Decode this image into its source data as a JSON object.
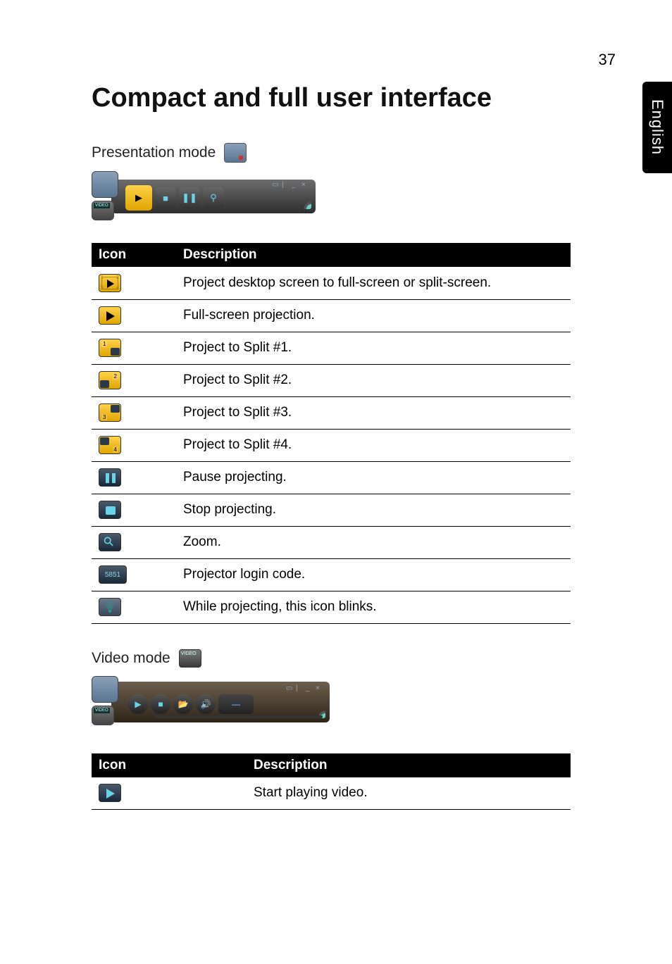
{
  "page_number": "37",
  "side_tab": "English",
  "heading": "Compact and full user interface",
  "presentation": {
    "label": "Presentation mode",
    "table": {
      "headers": {
        "icon": "Icon",
        "desc": "Description"
      },
      "rows": [
        {
          "desc": "Project desktop screen to full-screen or split-screen."
        },
        {
          "desc": "Full-screen projection."
        },
        {
          "desc": "Project to Split #1."
        },
        {
          "desc": "Project to Split #2."
        },
        {
          "desc": "Project to Split #3."
        },
        {
          "desc": "Project to Split #4."
        },
        {
          "desc": "Pause projecting."
        },
        {
          "desc": "Stop projecting."
        },
        {
          "desc": "Zoom."
        },
        {
          "desc": "Projector login code.",
          "code": "5851"
        },
        {
          "desc": "While projecting, this icon blinks."
        }
      ]
    }
  },
  "video": {
    "label": "Video mode",
    "tab_text": "VIDEO",
    "table": {
      "headers": {
        "icon": "Icon",
        "desc": "Description"
      },
      "rows": [
        {
          "desc": "Start playing video."
        }
      ]
    }
  }
}
